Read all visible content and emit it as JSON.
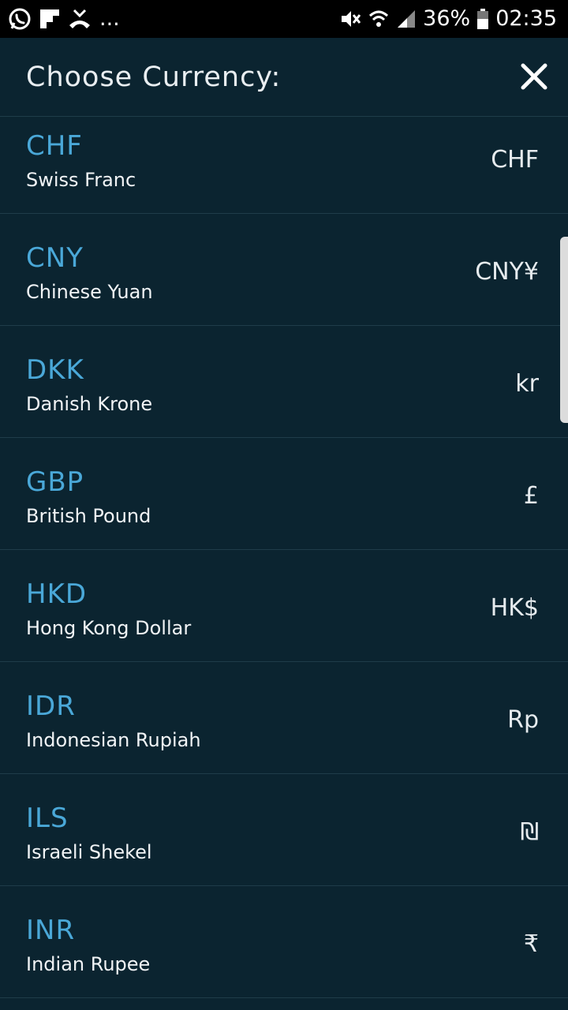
{
  "status_bar": {
    "battery_percent": "36%",
    "time": "02:35",
    "overflow": "...",
    "icons_left": [
      "whatsapp-icon",
      "flipboard-icon",
      "missed-call-icon"
    ],
    "icons_right": [
      "mute-icon",
      "wifi-icon",
      "signal-icon",
      "battery-icon"
    ]
  },
  "header": {
    "title": "Choose Currency:",
    "close_icon": "close-icon"
  },
  "currencies": [
    {
      "code": "CHF",
      "name": "Swiss Franc",
      "symbol": "CHF"
    },
    {
      "code": "CNY",
      "name": "Chinese Yuan",
      "symbol": "CNY¥"
    },
    {
      "code": "DKK",
      "name": "Danish Krone",
      "symbol": "kr"
    },
    {
      "code": "GBP",
      "name": "British Pound",
      "symbol": "£"
    },
    {
      "code": "HKD",
      "name": "Hong Kong Dollar",
      "symbol": "HK$"
    },
    {
      "code": "IDR",
      "name": "Indonesian Rupiah",
      "symbol": "Rp"
    },
    {
      "code": "ILS",
      "name": "Israeli Shekel",
      "symbol": "₪"
    },
    {
      "code": "INR",
      "name": "Indian Rupee",
      "symbol": "₹"
    }
  ],
  "colors": {
    "background": "#0b2430",
    "code_accent": "#4aa8d8",
    "divider": "#1f3c49"
  }
}
